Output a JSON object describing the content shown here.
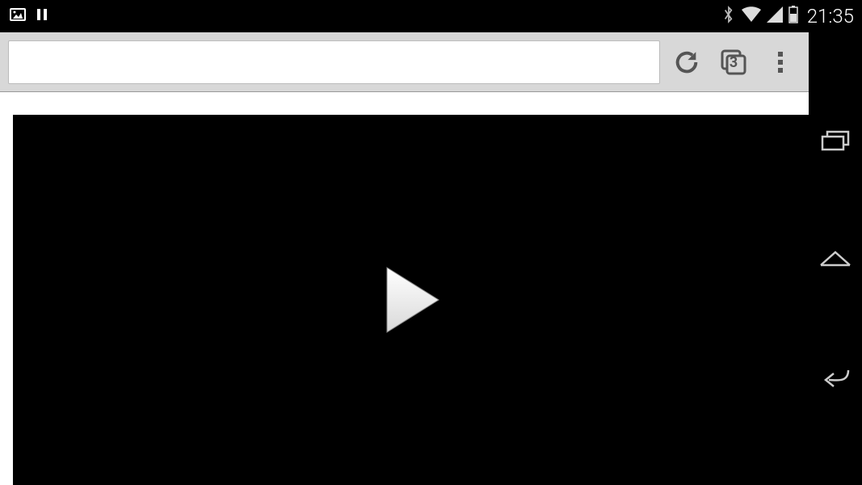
{
  "status_bar": {
    "clock": "21:35",
    "icons": {
      "picture": "picture-icon",
      "pause": "pause-icon",
      "bluetooth": "bluetooth-icon",
      "wifi": "wifi-icon",
      "signal": "signal-icon",
      "battery": "battery-icon"
    }
  },
  "browser": {
    "url_value": "",
    "url_placeholder": "",
    "tab_count": "3",
    "actions": {
      "reload": "reload",
      "tabs": "tabs",
      "menu": "menu"
    }
  },
  "video": {
    "state": "paused",
    "play_label": "Play"
  },
  "nav": {
    "recent": "recent-apps",
    "home": "home",
    "back": "back"
  }
}
